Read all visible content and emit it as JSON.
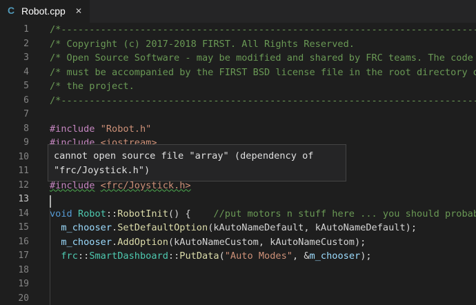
{
  "tab": {
    "icon_glyph": "C",
    "icon_name": "cpp-file-icon",
    "icon_color": "#519aba",
    "title": "Robot.cpp",
    "close_glyph": "✕"
  },
  "editor": {
    "line_numbers": [
      "1",
      "2",
      "3",
      "4",
      "5",
      "6",
      "7",
      "8",
      "9",
      "10",
      "11",
      "12",
      "13",
      "14",
      "15",
      "16",
      "17",
      "18",
      "19",
      "20"
    ],
    "active_line": "13",
    "lines": {
      "l1": "/*----------------------------------------------------------------------------*/",
      "l2": "/* Copyright (c) 2017-2018 FIRST. All Rights Reserved.",
      "l3": "/* Open Source Software - may be modified and shared by FRC teams. The code",
      "l4": "/* must be accompanied by the FIRST BSD license file in the root directory of",
      "l5": "/* the project.",
      "l6": "/*----------------------------------------------------------------------------*/",
      "l8_directive": "#include",
      "l8_file": "\"Robot.h\"",
      "l9_directive": "#include",
      "l9_file": "<iostream>",
      "l12_directive": "#include",
      "l12_file": "<frc/Joystick.h>",
      "l14": {
        "keyword": "void",
        "class_name": "Robot",
        "sep": "::",
        "method": "RobotInit",
        "rest": "() {    ",
        "comment": "//put motors n stuff here ... you should probably"
      },
      "l15": {
        "obj": "m_chooser",
        "dot": ".",
        "method": "SetDefaultOption",
        "open": "(",
        "arg1": "kAutoNameDefault",
        "comma": ", ",
        "arg2": "kAutoNameDefault",
        "close": ");"
      },
      "l16": {
        "obj": "m_chooser",
        "dot": ".",
        "method": "AddOption",
        "open": "(",
        "arg1": "kAutoNameCustom",
        "comma": ", ",
        "arg2": "kAutoNameCustom",
        "close": ");"
      },
      "l17": {
        "ns": "frc",
        "sep1": "::",
        "cls": "SmartDashboard",
        "sep2": "::",
        "method": "PutData",
        "open": "(",
        "str": "\"Auto Modes\"",
        "mid": ", &",
        "arg": "m_chooser",
        "close": ");"
      }
    }
  },
  "hover": {
    "line1": "cannot open source file \"array\" (dependency of",
    "line2": "\"frc/Joystick.h\")"
  },
  "colors": {
    "background": "#1e1e1e",
    "comment": "#6a9955",
    "preprocessor": "#c586c0",
    "string": "#ce9178",
    "keyword": "#569cd6",
    "type": "#4ec9b0",
    "function": "#dcdcaa",
    "variable": "#9cdcfe",
    "squiggle": "#4caf50"
  }
}
